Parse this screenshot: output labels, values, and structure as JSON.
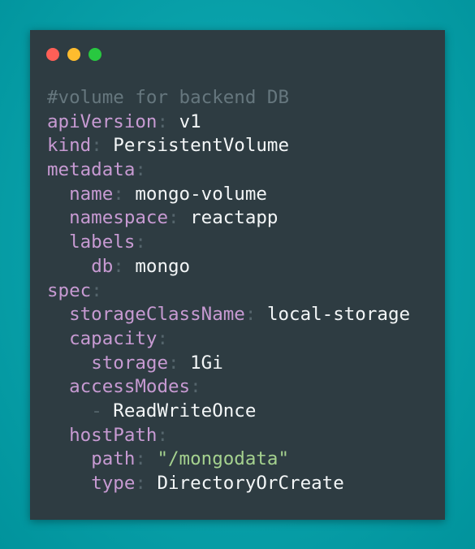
{
  "window": {
    "controls": [
      {
        "name": "close",
        "color": "#ff5f57"
      },
      {
        "name": "minimize",
        "color": "#febc2e"
      },
      {
        "name": "maximize",
        "color": "#28c840"
      }
    ]
  },
  "code": {
    "language": "yaml",
    "lines": [
      {
        "indent": "",
        "comment": "#volume for backend DB"
      },
      {
        "indent": "",
        "key": "apiVersion",
        "value": "v1"
      },
      {
        "indent": "",
        "key": "kind",
        "value": "PersistentVolume"
      },
      {
        "indent": "",
        "key": "metadata"
      },
      {
        "indent": "  ",
        "key": "name",
        "value": "mongo-volume"
      },
      {
        "indent": "  ",
        "key": "namespace",
        "value": "reactapp"
      },
      {
        "indent": "  ",
        "key": "labels"
      },
      {
        "indent": "    ",
        "key": "db",
        "value": "mongo"
      },
      {
        "indent": "",
        "key": "spec"
      },
      {
        "indent": "  ",
        "key": "storageClassName",
        "value": "local-storage"
      },
      {
        "indent": "  ",
        "key": "capacity"
      },
      {
        "indent": "    ",
        "key": "storage",
        "value": "1Gi"
      },
      {
        "indent": "  ",
        "key": "accessModes"
      },
      {
        "indent": "    ",
        "dash": "-",
        "value": "ReadWriteOnce"
      },
      {
        "indent": "  ",
        "key": "hostPath"
      },
      {
        "indent": "    ",
        "key": "path",
        "string": "\"/mongodata\""
      },
      {
        "indent": "    ",
        "key": "type",
        "value": "DirectoryOrCreate"
      }
    ]
  }
}
